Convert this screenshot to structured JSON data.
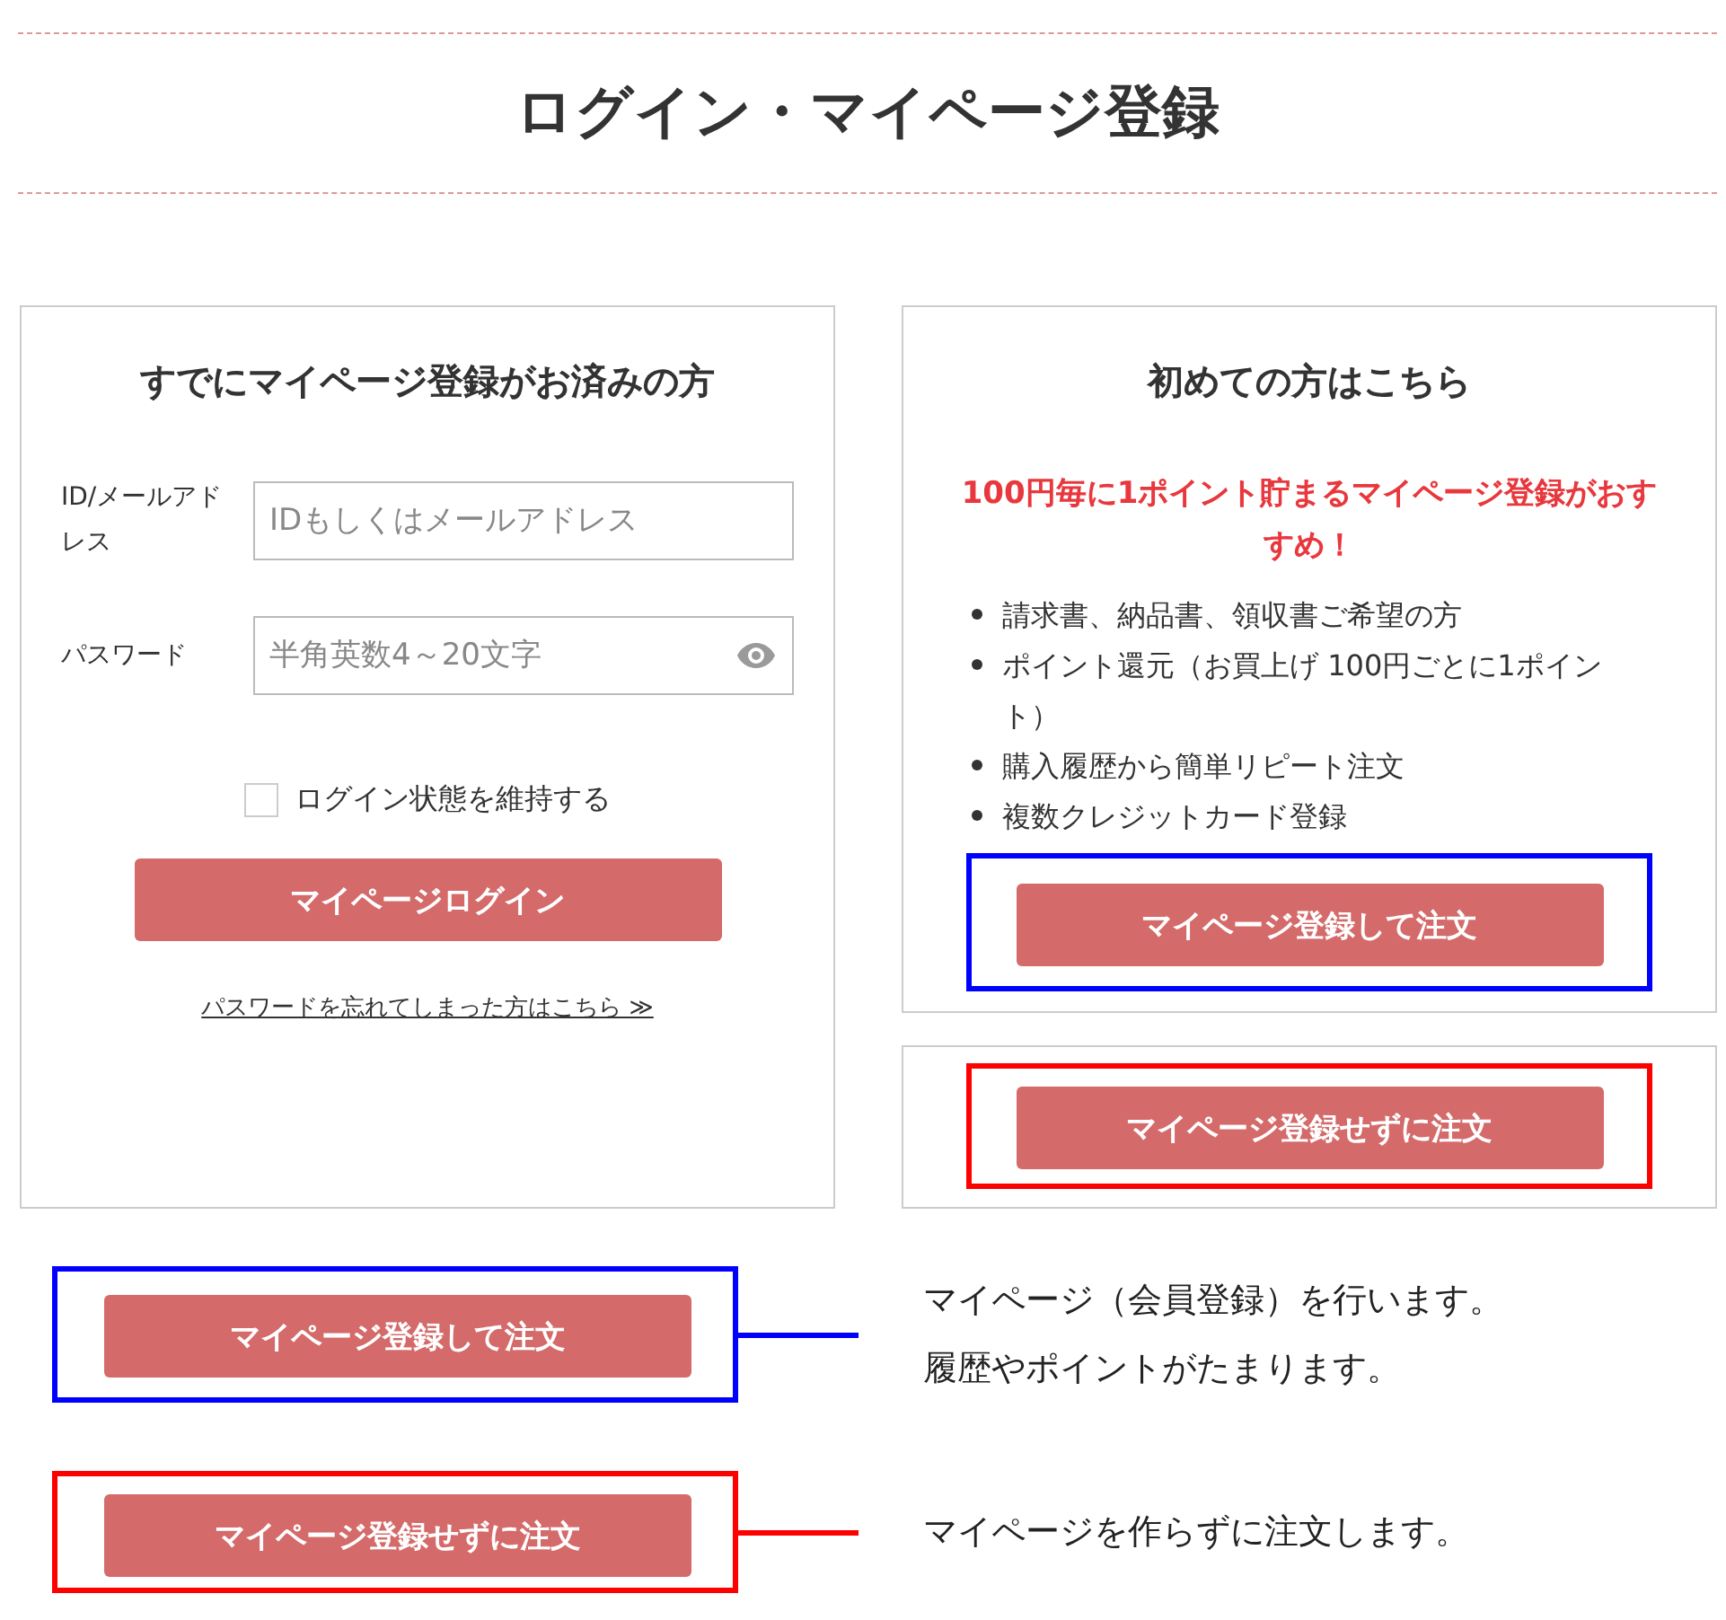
{
  "page_title": "ログイン・マイページ登録",
  "login": {
    "title": "すでにマイページ登録がお済みの方",
    "fields": [
      {
        "kind": "text",
        "label": "ID/メールアドレス",
        "placeholder": "IDもしくはメールアドレス"
      },
      {
        "kind": "password",
        "label": "パスワード",
        "placeholder": "半角英数4～20文字"
      }
    ],
    "remember": {
      "label": "ログイン状態を維持する",
      "checked": false
    },
    "button": "マイページログイン",
    "link": "パスワードを忘れてしまった方はこちら ≫"
  },
  "signup": {
    "title": "初めての方はこちら",
    "promo": "100円毎に1ポイント貯まるマイページ登録がおすすめ！",
    "benefits": [
      "請求書、納品書、領収書ご希望の方",
      "ポイント還元（お買上げ 100円ごとに1ポイント）",
      "購入履歴から簡単リピート注文",
      "複数クレジットカード登録"
    ],
    "button": {
      "label": "マイページ登録して注文",
      "color": "#0000ff"
    }
  },
  "guest": {
    "button": {
      "label": "マイページ登録せずに注文",
      "color": "#ff0000"
    }
  },
  "legend": [
    {
      "button": "マイページ登録して注文",
      "color": "#0000ff",
      "lines": [
        "マイページ（会員登録）を行います。",
        "履歴やポイントがたまります。"
      ]
    },
    {
      "button": "マイページ登録せずに注文",
      "color": "#ff0000",
      "lines": [
        "マイページを作らずに注文します。"
      ]
    }
  ]
}
